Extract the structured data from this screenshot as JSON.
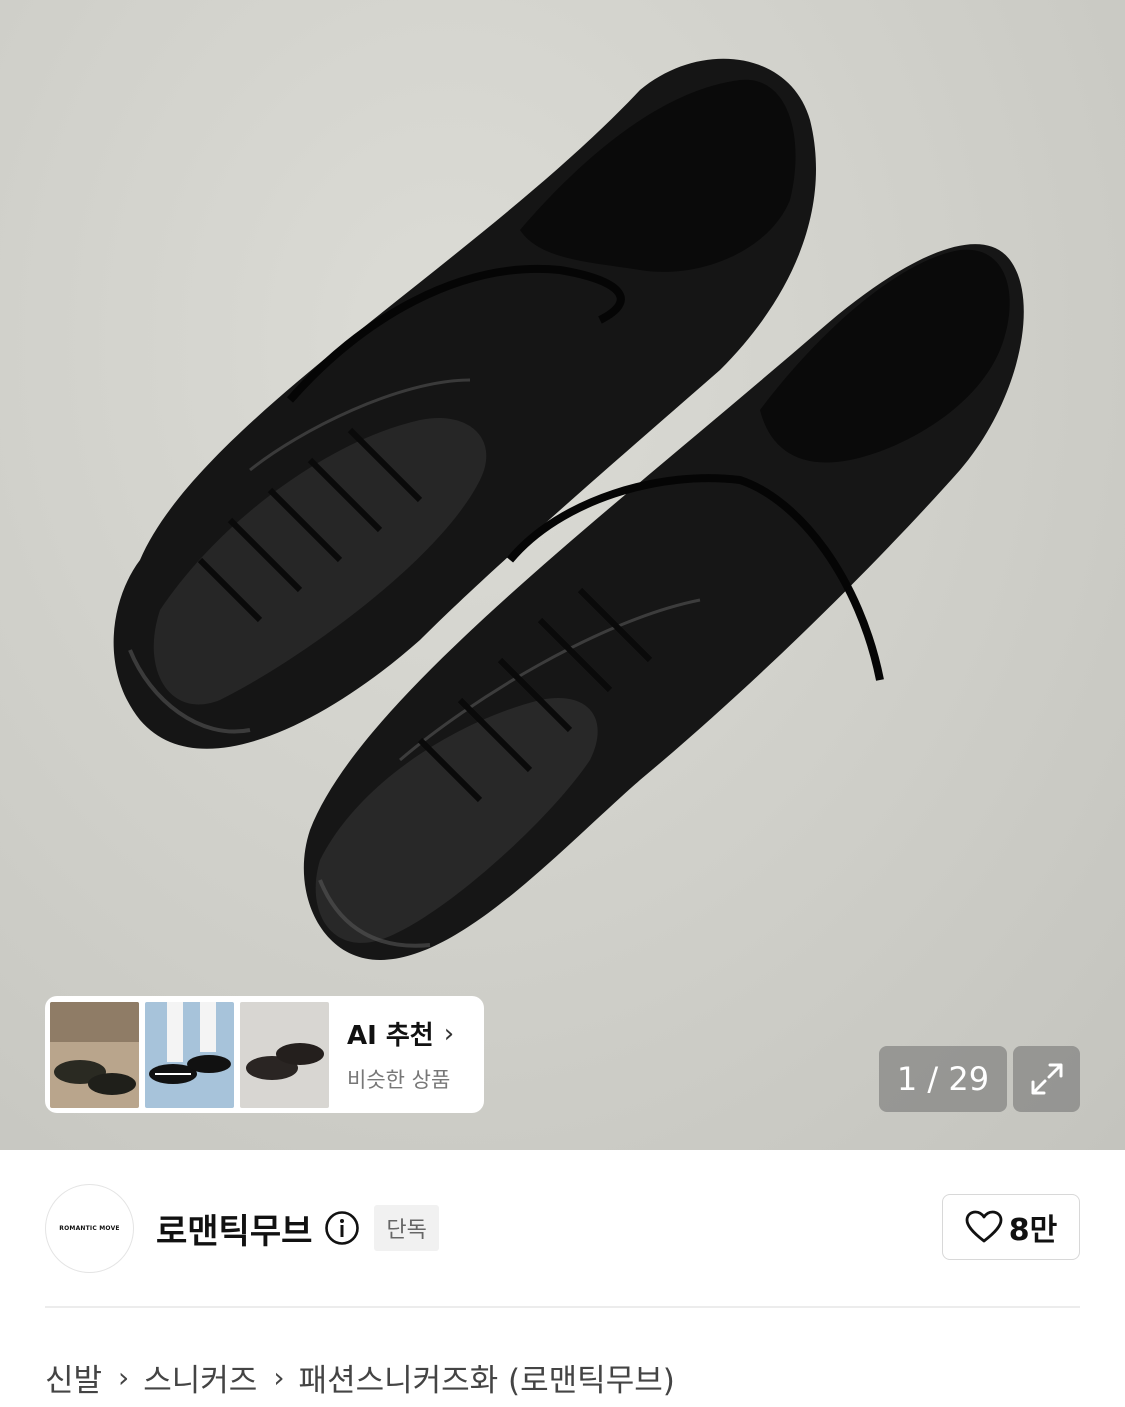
{
  "gallery": {
    "counter": "1 / 29"
  },
  "ai_recommend": {
    "title": "AI 추천",
    "subtitle": "비슷한 상품"
  },
  "brand": {
    "logo_text": "ROMANTIC MOVE",
    "name": "로맨틱무브",
    "badge": "단독",
    "likes": "8만"
  },
  "breadcrumb": [
    "신발",
    "스니커즈",
    "패션스니커즈화 (로맨틱무브)"
  ]
}
